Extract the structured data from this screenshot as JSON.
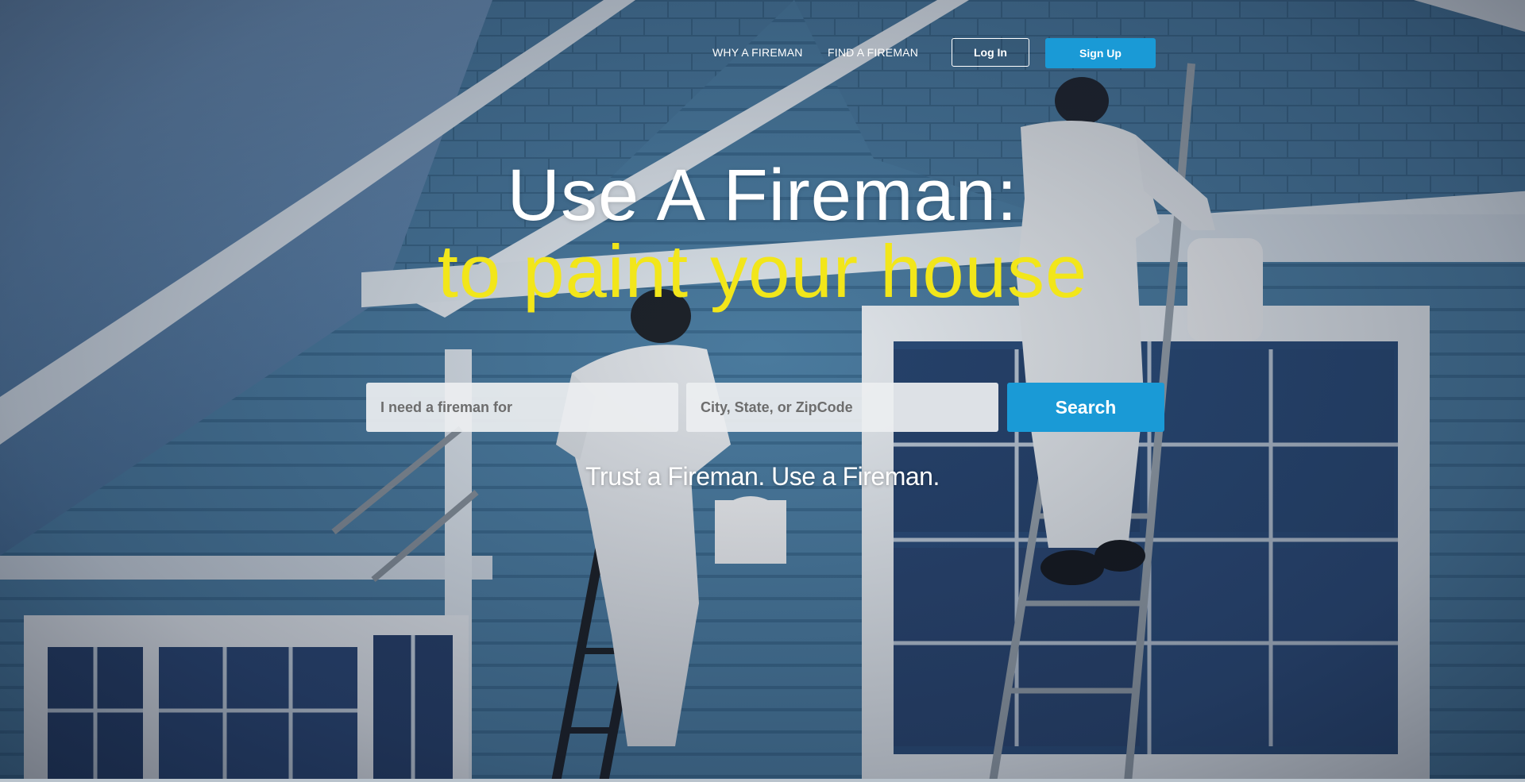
{
  "nav": {
    "why_label": "WHY A FIREMAN",
    "find_label": "FIND A FIREMAN",
    "login_label": "Log In",
    "signup_label": "Sign Up"
  },
  "hero": {
    "headline": "Use A Fireman:",
    "subheadline": "to paint your house",
    "tagline": "Trust a Fireman. Use a Fireman.",
    "background_description_icon": "house-painters-photo"
  },
  "search": {
    "service_placeholder": "I need a fireman for",
    "location_placeholder": "City, State, or ZipCode",
    "button_label": "Search"
  },
  "colors": {
    "accent": "#1a9ad6",
    "highlight": "#f2e61a"
  }
}
